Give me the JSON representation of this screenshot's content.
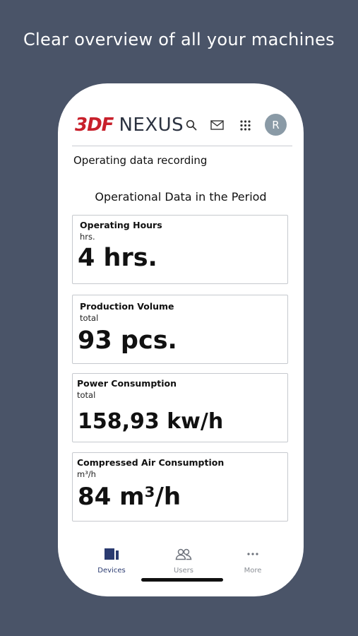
{
  "headline": "Clear overview of all your machines",
  "header": {
    "logo_mark": "3DF",
    "logo_text": "NEXUS",
    "avatar_initial": "R",
    "icons": [
      "search-icon",
      "mail-icon",
      "apps-grid-icon"
    ]
  },
  "section_title": "Operating data recording",
  "period_title": "Operational Data in  the Period",
  "cards": [
    {
      "title": "Operating Hours",
      "unit": "hrs.",
      "value": "4 hrs."
    },
    {
      "title": "Production Volume",
      "unit": "total",
      "value": "93 pcs."
    },
    {
      "title": "Power Consumption",
      "unit": "total",
      "value": "158,93 kw/h"
    },
    {
      "title": "Compressed Air Consumption",
      "unit": "m³/h",
      "value": "84 m³/h"
    }
  ],
  "tabs": [
    {
      "label": "Devices",
      "icon": "devices-icon",
      "active": true
    },
    {
      "label": "Users",
      "icon": "users-icon",
      "active": false
    },
    {
      "label": "More",
      "icon": "more-icon",
      "active": false
    }
  ],
  "colors": {
    "background": "#4a5468",
    "brand_red": "#c8202b",
    "accent": "#2a3a70"
  }
}
